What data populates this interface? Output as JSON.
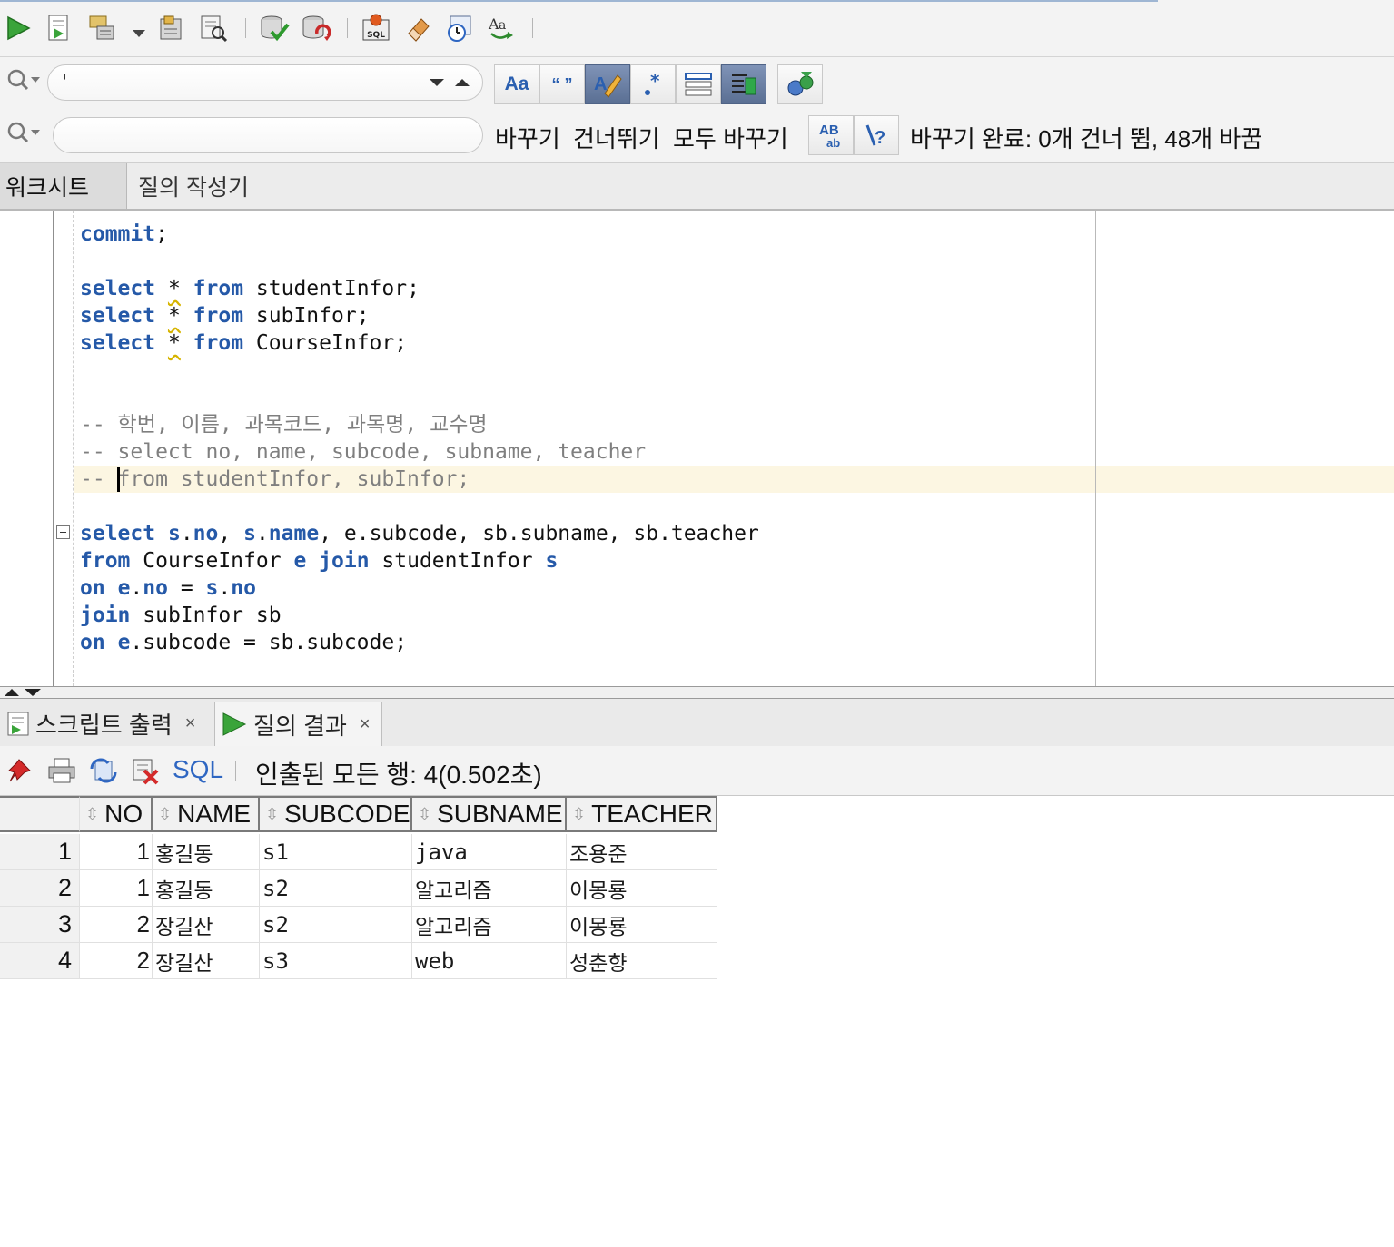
{
  "find": {
    "value": "'"
  },
  "replace": {
    "value": "",
    "replace_label": "바꾸기",
    "skip_label": "건너뛰기",
    "replace_all_label": "모두 바꾸기",
    "status": "바꾸기 완료: 0개 건너 뜀, 48개 바꿈"
  },
  "editor_tabs": [
    "워크시트",
    "질의 작성기"
  ],
  "code": {
    "commit": "commit",
    "select_1_table": "studentInfor;",
    "select_2_table": "subInfor;",
    "select_3_table": "CourseInfor;",
    "comment_1": "-- 학번, 이름, 과목코드, 과목명, 교수명",
    "comment_2": "-- select no, name, subcode, subname, teacher",
    "comment_3": "-- from studentInfor, subInfor;",
    "join_select_rest": "e.subcode, sb.subname, sb.teacher",
    "join_from_table": "CourseInfor",
    "join_from_table2": "studentInfor",
    "join_sub_table": "subInfor sb",
    "join_on_2_rest": "subcode = sb.subcode;"
  },
  "bottom_tabs": {
    "script_output": "스크립트 출력",
    "query_result": "질의 결과"
  },
  "results_toolbar": {
    "sql_label": "SQL",
    "rows_fetched": "인출된 모든 행: 4(0.502초)"
  },
  "table": {
    "columns": [
      "NO",
      "NAME",
      "SUBCODE",
      "SUBNAME",
      "TEACHER"
    ],
    "rows": [
      {
        "rownum": "1",
        "no": "1",
        "name": "홍길동",
        "subcode": "s1",
        "subname": "java",
        "teacher": "조용준"
      },
      {
        "rownum": "2",
        "no": "1",
        "name": "홍길동",
        "subcode": "s2",
        "subname": "알고리즘",
        "teacher": "이몽룡"
      },
      {
        "rownum": "3",
        "no": "2",
        "name": "장길산",
        "subcode": "s2",
        "subname": "알고리즘",
        "teacher": "이몽룡"
      },
      {
        "rownum": "4",
        "no": "2",
        "name": "장길산",
        "subcode": "s3",
        "subname": "web",
        "teacher": "성춘향"
      }
    ]
  },
  "colors": {
    "keyword": "#2559a8",
    "comment": "#7f7f7f",
    "current_line": "#fcf6e2",
    "sql_link": "#2e66c2"
  },
  "icons": [
    "run-statement-icon",
    "run-script-icon",
    "explain-plan-icon",
    "autotrace-icon",
    "commit-icon",
    "rollback-icon",
    "sql-tuning-icon",
    "clear-icon",
    "history-icon",
    "case-icon",
    "pin-icon",
    "print-icon",
    "refresh-icon",
    "clear-results-icon"
  ]
}
